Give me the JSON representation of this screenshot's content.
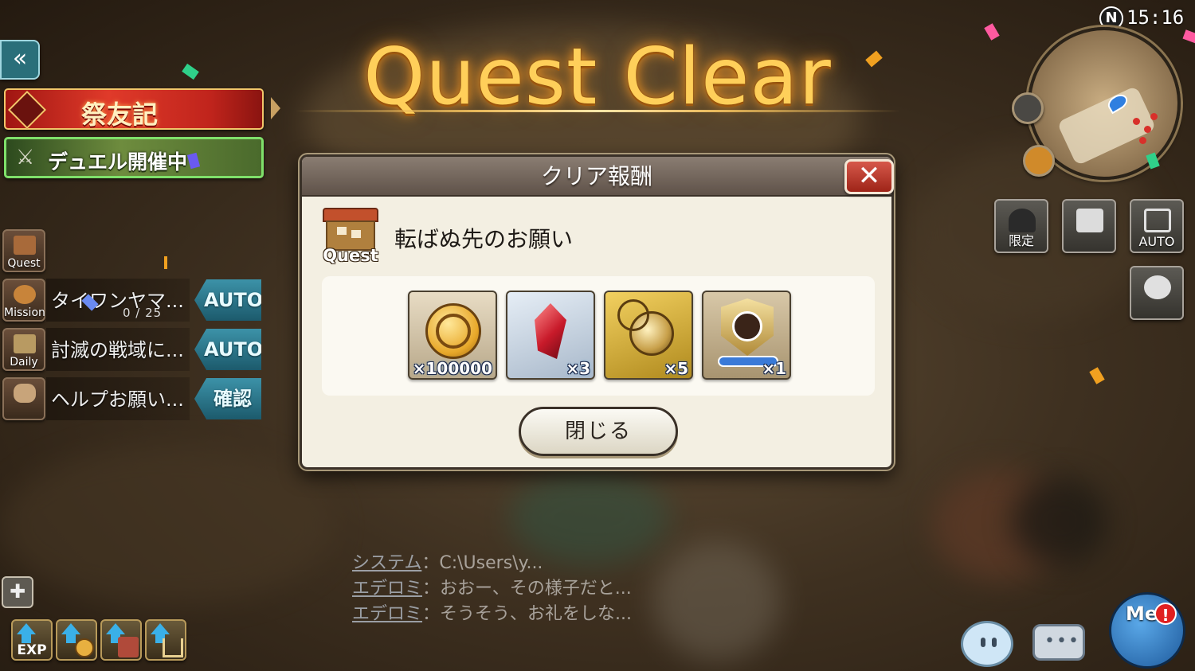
{
  "status_bar": {
    "time": "15:16",
    "network_badge": "N"
  },
  "title": "Quest Clear",
  "left_panel": {
    "back_icon": "double-chevron-left-icon",
    "event_banner": "祭友記",
    "duel_banner": "デュエル開催中",
    "rows": [
      {
        "tag": "Quest",
        "text": "",
        "count": "",
        "action": ""
      },
      {
        "tag": "Mission",
        "text": "タイワンヤマ...",
        "count": "0 / 25",
        "action": "AUTO"
      },
      {
        "tag": "Daily",
        "text": "討滅の戦域に...",
        "count": "",
        "action": "AUTO"
      },
      {
        "tag": "",
        "text": "ヘルプお願い...",
        "count": "",
        "action": "確認"
      }
    ],
    "bottom_icons": [
      {
        "name": "exp-up-icon",
        "label": "EXP"
      },
      {
        "name": "coin-up-icon",
        "label": ""
      },
      {
        "name": "boot-up-icon",
        "label": ""
      },
      {
        "name": "basket-up-icon",
        "label": ""
      }
    ]
  },
  "right_panel": {
    "buttons": [
      {
        "name": "limited-button",
        "label": "限定"
      },
      {
        "name": "camera-button",
        "label": ""
      },
      {
        "name": "auto-button",
        "label": "AUTO"
      },
      {
        "name": "party-button",
        "label": ""
      }
    ],
    "me_label": "Me",
    "me_alert": "!"
  },
  "chat": [
    {
      "name": "システム",
      "sep": "：",
      "text": "C:\\Users\\y..."
    },
    {
      "name": "エデロミ",
      "sep": "：",
      "text": "おおー、その様子だと..."
    },
    {
      "name": "エデロミ",
      "sep": "：",
      "text": "そうそう、お礼をしな..."
    }
  ],
  "modal": {
    "title": "クリア報酬",
    "close_x": "✕",
    "quest_badge": "Quest",
    "quest_name": "転ばぬ先のお願い",
    "rewards": [
      {
        "icon": "gold-coin-icon",
        "count": "×100000"
      },
      {
        "icon": "red-crystal-icon",
        "count": "×3"
      },
      {
        "icon": "gold-pendant-icon",
        "count": "×5"
      },
      {
        "icon": "character-medal-icon",
        "count": "×1"
      }
    ],
    "close_button": "閉じる"
  },
  "colors": {
    "accent_gold": "#ffcf5a",
    "close_red": "#c8392b",
    "auto_teal": "#2f7f92"
  }
}
